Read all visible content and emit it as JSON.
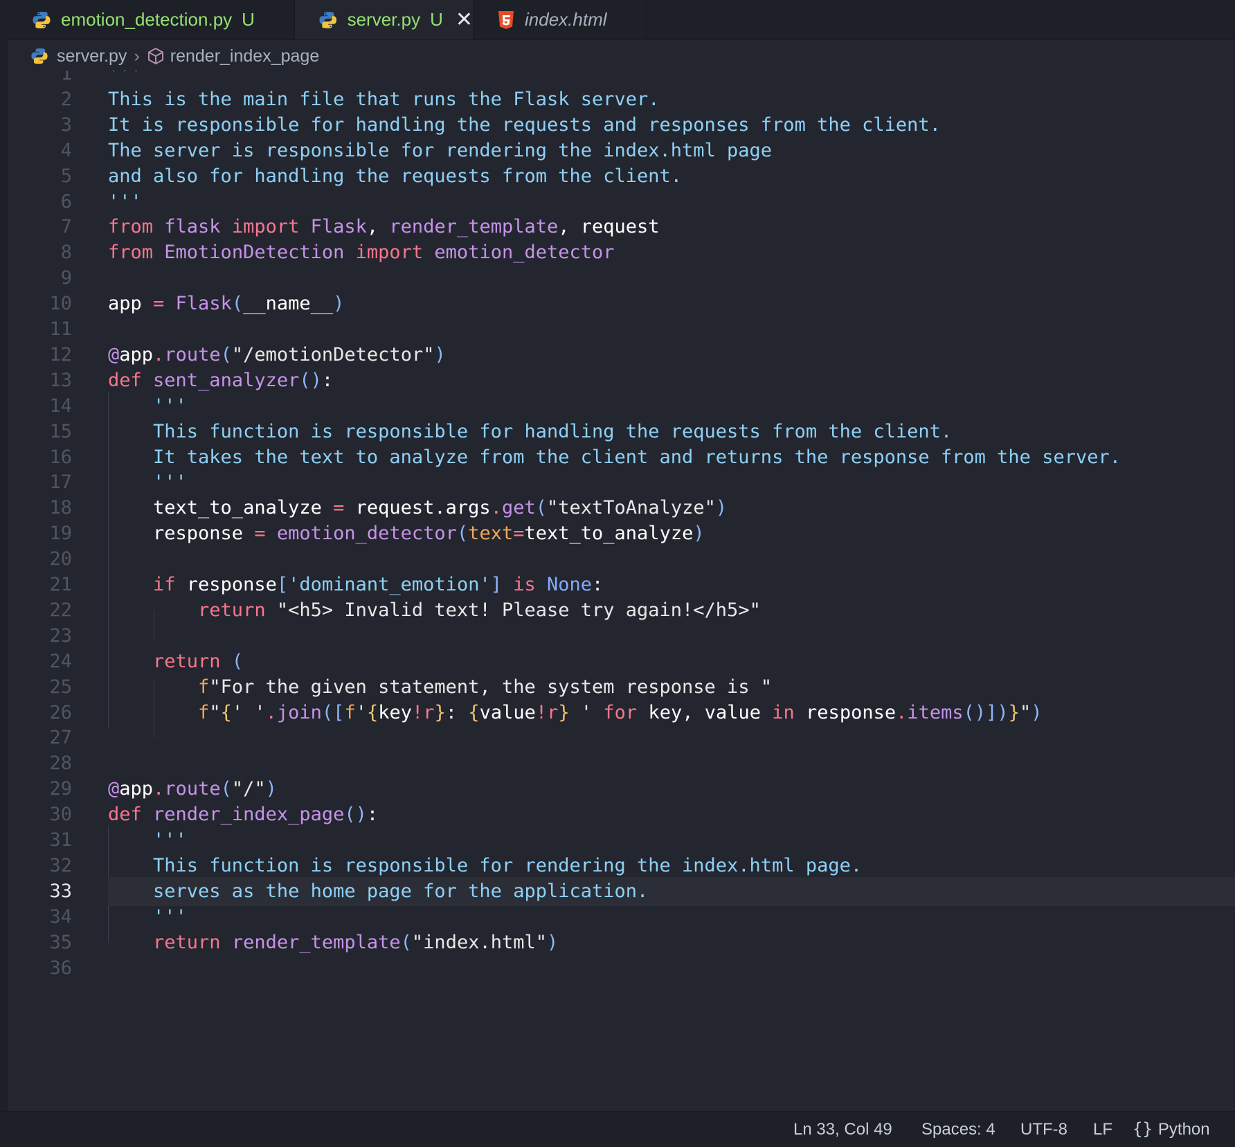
{
  "tabs": [
    {
      "label": "emotion_detection.py",
      "status": "U",
      "icon": "python-icon"
    },
    {
      "label": "server.py",
      "status": "U",
      "icon": "python-icon",
      "active": true
    },
    {
      "label": "index.html",
      "icon": "html5-icon"
    }
  ],
  "breadcrumb": {
    "file": "server.py",
    "symbol": "render_index_page"
  },
  "editor": {
    "line_numbers": [
      "1",
      "2",
      "3",
      "4",
      "5",
      "6",
      "7",
      "8",
      "9",
      "10",
      "11",
      "12",
      "13",
      "14",
      "15",
      "16",
      "17",
      "18",
      "19",
      "20",
      "21",
      "22",
      "23",
      "24",
      "25",
      "26",
      "27",
      "28",
      "29",
      "30",
      "31",
      "32",
      "33",
      "34",
      "35",
      "36"
    ],
    "current_line": 33
  },
  "status": {
    "position": "Ln 33, Col 49",
    "spaces": "Spaces: 4",
    "encoding": "UTF-8",
    "eol": "LF",
    "language": "Python"
  },
  "colors": {
    "background": "#23262e",
    "docstring": "#8ed0f7",
    "keyword": "#f7768e",
    "function": "#c792ea",
    "modified": "#96e072"
  }
}
